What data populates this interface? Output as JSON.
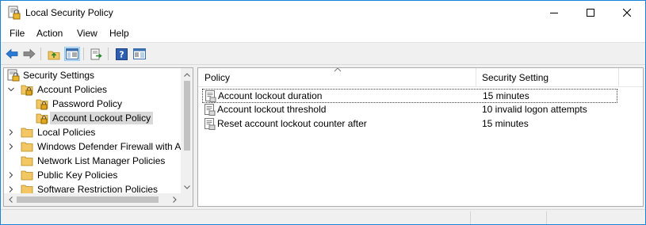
{
  "window": {
    "title": "Local Security Policy",
    "controls": [
      "minimize-icon",
      "maximize-icon",
      "close-icon"
    ]
  },
  "menu": [
    "File",
    "Action",
    "View",
    "Help"
  ],
  "toolbar": {
    "buttons": [
      "back-arrow-icon",
      "forward-arrow-icon",
      "up-folder-icon",
      "show-hide-tree-icon",
      "export-list-icon",
      "help-icon",
      "properties-icon"
    ]
  },
  "tree": {
    "items": [
      {
        "label": "Security Settings",
        "level": 0,
        "expanded": true,
        "icon": "security-settings-icon"
      },
      {
        "label": "Account Policies",
        "level": 1,
        "expanded": true,
        "icon": "folder-lock-icon"
      },
      {
        "label": "Password Policy",
        "level": 2,
        "icon": "folder-lock-icon"
      },
      {
        "label": "Account Lockout Policy",
        "level": 2,
        "selected": true,
        "icon": "folder-lock-icon"
      },
      {
        "label": "Local Policies",
        "level": 1,
        "expanded": false,
        "icon": "folder-icon"
      },
      {
        "label": "Windows Defender Firewall with A",
        "level": 1,
        "expanded": false,
        "icon": "folder-icon"
      },
      {
        "label": "Network List Manager Policies",
        "level": 1,
        "icon": "folder-icon"
      },
      {
        "label": "Public Key Policies",
        "level": 1,
        "expanded": false,
        "icon": "folder-icon"
      },
      {
        "label": "Software Restriction Policies",
        "level": 1,
        "expanded": false,
        "icon": "folder-icon"
      }
    ]
  },
  "list": {
    "columns": [
      "Policy",
      "Security Setting"
    ],
    "rows": [
      {
        "policy": "Account lockout duration",
        "setting": "15 minutes"
      },
      {
        "policy": "Account lockout threshold",
        "setting": "10 invalid logon attempts"
      },
      {
        "policy": "Reset account lockout counter after",
        "setting": "15 minutes"
      }
    ]
  },
  "colors": {
    "window_border": "#1883d7",
    "selection": "#d9d9d9",
    "folder": "#f3c763"
  }
}
